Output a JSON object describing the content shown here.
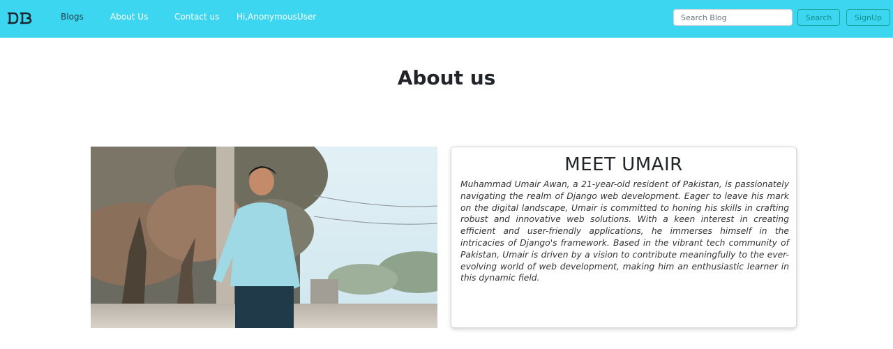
{
  "navbar": {
    "brand": "DB",
    "links": [
      {
        "label": "Blogs"
      },
      {
        "label": "About Us"
      },
      {
        "label": "Contact us"
      },
      {
        "label": "Hi,AnonymousUser"
      }
    ],
    "search": {
      "placeholder": "Search Blog",
      "value": ""
    },
    "search_button": "Search",
    "signup_button": "SignUp",
    "colors": {
      "background": "#3dd6f0",
      "accent": "#1aa6a0"
    }
  },
  "page": {
    "title": "About us"
  },
  "profile": {
    "photo_icon": "person-photo",
    "heading": "MEET UMAIR",
    "bio": "Muhammad Umair Awan, a 21-year-old resident of Pakistan, is passionately navigating the realm of Django web development. Eager to leave his mark on the digital landscape, Umair is committed to honing his skills in crafting robust and innovative web solutions. With a keen interest in creating efficient and user-friendly applications, he immerses himself in the intricacies of Django's framework. Based in the vibrant tech community of Pakistan, Umair is driven by a vision to contribute meaningfully to the ever-evolving world of web development, making him an enthusiastic learner in this dynamic field."
  }
}
